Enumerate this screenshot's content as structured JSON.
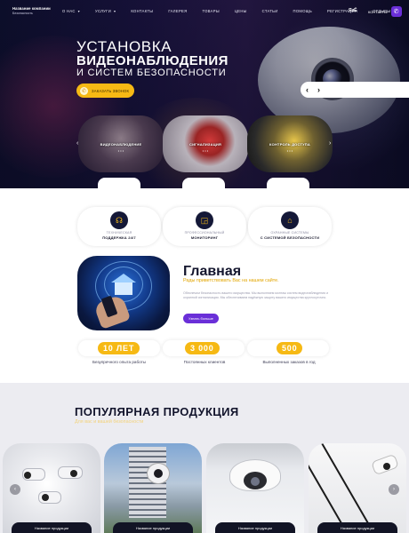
{
  "header": {
    "logo_line1": "Название компании",
    "logo_line2": "Безопасность",
    "menu": [
      {
        "label": "О НАС"
      },
      {
        "label": "УСЛУГИ"
      },
      {
        "label": "КОНТАКТЫ"
      },
      {
        "label": "ГАЛЕРЕЯ"
      },
      {
        "label": "ТОВАРЫ"
      },
      {
        "label": "ЦЕНЫ"
      },
      {
        "label": "СТАТЬИ"
      },
      {
        "label": "ПОМОЩЬ"
      },
      {
        "label": "РЕГИСТРАЦИЯ"
      },
      {
        "label": "ОТЗЫВЫ"
      }
    ],
    "lang": "ЯzЁ",
    "contacts_label": "КОНТАКТЫ",
    "contacts_icon": "phone-icon"
  },
  "hero": {
    "title_line1": "УСТАНОВКА",
    "title_line2": "ВИДЕОНАБЛЮДЕНИЯ",
    "title_line3": "И СИСТЕМ БЕЗОПАСНОСТИ",
    "cta_label": "ЗАКАЗАТЬ ЗВОНОК",
    "cta_icon": "phone-icon",
    "prev_arrow": "‹",
    "next_arrow": "›",
    "categories": [
      {
        "label": "ВИДЕОНАБЛЮДЕНИЕ",
        "dots": "• • •"
      },
      {
        "label": "СИГНАЛИЗАЦИЯ",
        "dots": "• • •"
      },
      {
        "label": "КОНТРОЛЬ ДОСТУПА",
        "dots": "• • •"
      }
    ],
    "cat_prev": "‹",
    "cat_next": "›"
  },
  "features": [
    {
      "caption": "ТЕХНИЧЕСКАЯ",
      "value": "ПОДДЕРЖКА 24/7",
      "icon": "headset-icon"
    },
    {
      "caption": "ПРОФЕССИОНАЛЬНЫЙ",
      "value": "МОНИТОРИНГ",
      "icon": "monitor-icon"
    },
    {
      "caption": "ОХРАННЫЕ СИСТЕМЫ",
      "value": "С СИСТЕМОЙ БЕЗОПАСНОСТИ",
      "icon": "lock-icon"
    }
  ],
  "about": {
    "title": "Главная",
    "subtitle": "Рады приветствовать Вас на нашем сайте.",
    "text": "Обеспечим безопасность вашего имущества. Мы выполняем монтаж систем видеонаблюдения и охранной сигнализации. Мы обеспечиваем надёжную защиту вашего имущества круглосуточно.",
    "button_label": "Узнать больше"
  },
  "stats": [
    {
      "number": "10 ЛЕТ",
      "caption": "Безупречного опыта работы"
    },
    {
      "number": "3 000",
      "caption": "Постоянных клиентов"
    },
    {
      "number": "500",
      "caption": "Выполненных заказов в год"
    }
  ],
  "products": {
    "title": "ПОПУЛЯРНАЯ ПРОДУКЦИЯ",
    "subtitle": "Для вас и вашей безопасности",
    "items": [
      {
        "caption": "Название продукции"
      },
      {
        "caption": "Название продукции"
      },
      {
        "caption": "Название продукции"
      },
      {
        "caption": "Название продукции"
      }
    ],
    "prev_arrow": "‹",
    "next_arrow": "›"
  },
  "colors": {
    "accent_yellow": "#f6b914",
    "accent_purple": "#6a2fd8",
    "dark_navy": "#14162e"
  }
}
